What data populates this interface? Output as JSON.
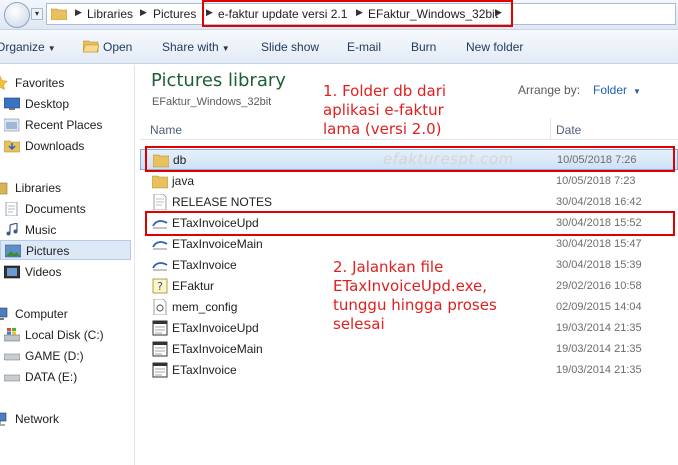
{
  "address": {
    "crumbs": [
      "Libraries",
      "Pictures",
      "e-faktur update versi 2.1",
      "EFaktur_Windows_32bit"
    ]
  },
  "toolbar": {
    "organize": "Organize",
    "open": "Open",
    "share_with": "Share with",
    "slide_show": "Slide show",
    "email": "E-mail",
    "burn": "Burn",
    "new_folder": "New folder"
  },
  "sidebar": {
    "favorites": "Favorites",
    "desktop": "Desktop",
    "recent_places": "Recent Places",
    "downloads": "Downloads",
    "libraries": "Libraries",
    "documents": "Documents",
    "music": "Music",
    "pictures": "Pictures",
    "videos": "Videos",
    "computer": "Computer",
    "local_disk": "Local Disk (C:)",
    "game": "GAME (D:)",
    "data": "DATA (E:)",
    "network": "Network"
  },
  "library": {
    "title": "Pictures library",
    "subtitle": "EFaktur_Windows_32bit",
    "arrange_label": "Arrange by:",
    "arrange_value": "Folder"
  },
  "columns": {
    "name": "Name",
    "date": "Date"
  },
  "files": [
    {
      "name": "db",
      "date": "10/05/2018 7:26",
      "icon": "folder-icon"
    },
    {
      "name": "java",
      "date": "10/05/2018 7:23",
      "icon": "folder-icon"
    },
    {
      "name": "RELEASE NOTES",
      "date": "30/04/2018 16:42",
      "icon": "text-file-icon"
    },
    {
      "name": "ETaxInvoiceUpd",
      "date": "30/04/2018 15:52",
      "icon": "app-icon"
    },
    {
      "name": "ETaxInvoiceMain",
      "date": "30/04/2018 15:47",
      "icon": "app-icon"
    },
    {
      "name": "ETaxInvoice",
      "date": "30/04/2018 15:39",
      "icon": "app-icon"
    },
    {
      "name": "EFaktur",
      "date": "29/02/2016 10:58",
      "icon": "help-file-icon"
    },
    {
      "name": "mem_config",
      "date": "02/09/2015 14:04",
      "icon": "config-file-icon"
    },
    {
      "name": "ETaxInvoiceUpd",
      "date": "19/03/2014 21:35",
      "icon": "window-file-icon"
    },
    {
      "name": "ETaxInvoiceMain",
      "date": "19/03/2014 21:35",
      "icon": "window-file-icon"
    },
    {
      "name": "ETaxInvoice",
      "date": "19/03/2014 21:35",
      "icon": "window-file-icon"
    }
  ],
  "annotations": {
    "note1": [
      "1. Folder db dari",
      "aplikasi e-faktur",
      "lama (versi 2.0)"
    ],
    "note2": [
      "2. Jalankan file",
      "ETaxInvoiceUpd.exe,",
      "tunggu hingga proses",
      "selesai"
    ],
    "watermark": "efakturespt.com"
  },
  "colors": {
    "annotation": "#e02020",
    "highlight_box": "#e00000",
    "library_title": "#1e5f3a"
  }
}
